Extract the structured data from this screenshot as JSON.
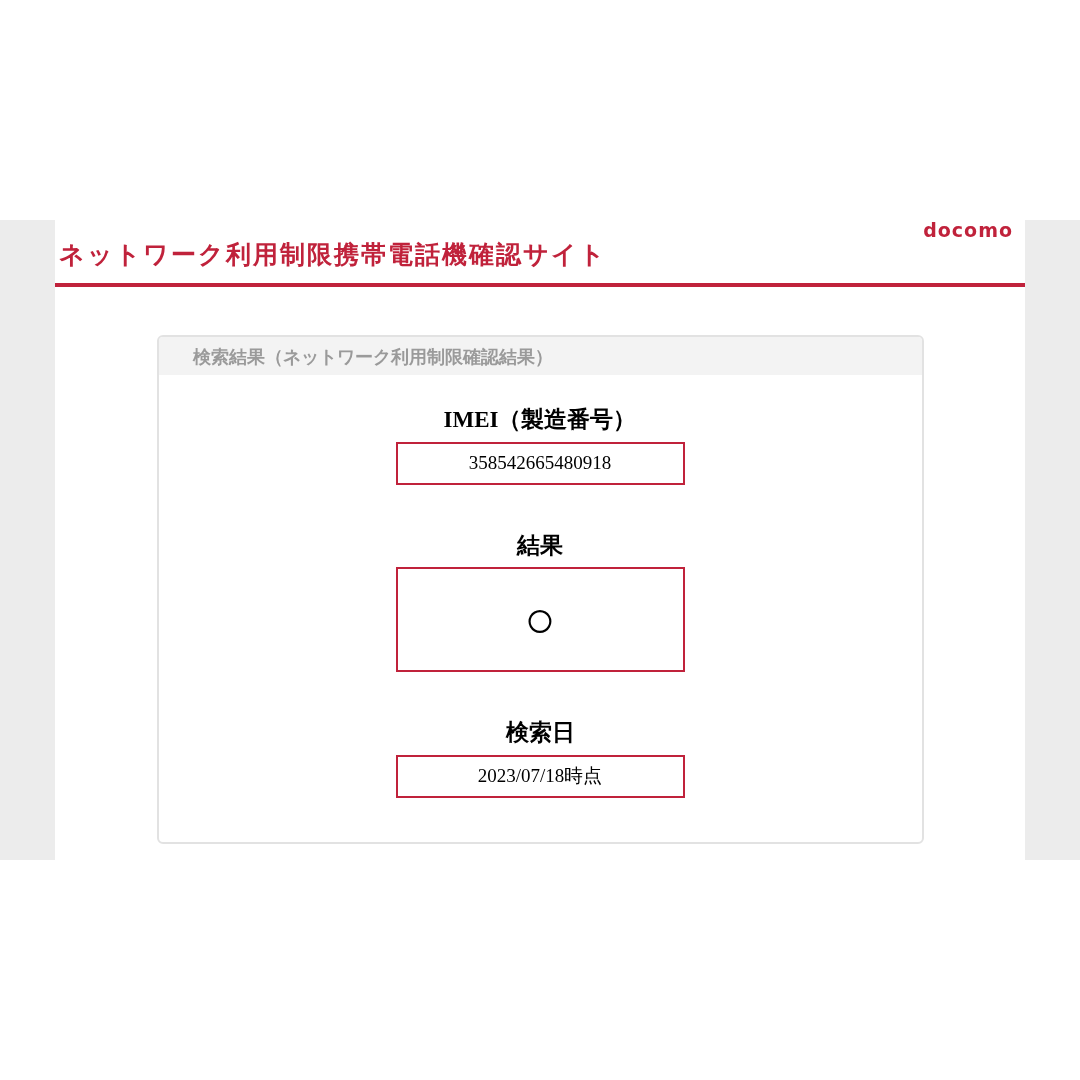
{
  "header": {
    "title": "ネットワーク利用制限携帯電話機確認サイト",
    "logo": "docomo"
  },
  "panel": {
    "title": "検索結果（ネットワーク利用制限確認結果）",
    "fields": [
      {
        "label": "IMEI（製造番号）",
        "value": "358542665480918",
        "kind": "text"
      },
      {
        "label": "結果",
        "value": "○",
        "kind": "mark"
      },
      {
        "label": "検索日",
        "value": "2023/07/18時点",
        "kind": "text"
      }
    ]
  }
}
